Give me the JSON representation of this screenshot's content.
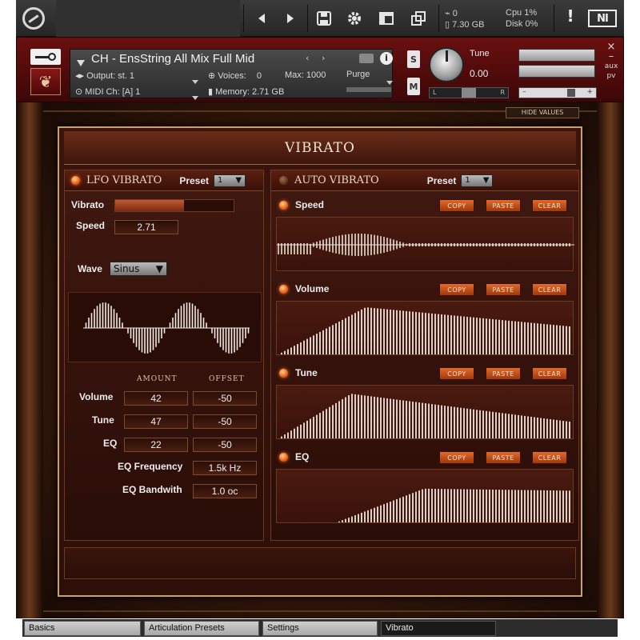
{
  "topbar": {
    "stats": {
      "voices": "0",
      "memory": "7.30 GB",
      "cpu_label": "Cpu",
      "cpu": "1%",
      "disk_label": "Disk",
      "disk": "0%"
    },
    "logo_text": "NI"
  },
  "instrument": {
    "name": "CH - EnsString All Mix Full Mid",
    "output_label": "Output:",
    "output": "st. 1",
    "voices_label": "Voices:",
    "voices": "0",
    "max_label": "Max:",
    "max": "1000",
    "purge": "Purge",
    "midi_label": "MIDI Ch:",
    "midi": "[A] 1",
    "memory_label": "Memory:",
    "memory": "2.71 GB",
    "s": "S",
    "m": "M",
    "tune_label": "Tune",
    "tune_value": "0.00",
    "pan_l": "L",
    "pan_r": "R",
    "side": {
      "close": "×",
      "minus": "–",
      "aux": "aux",
      "pv": "pv"
    }
  },
  "hide_values": "HIDE VALUES",
  "panel": {
    "title": "VIBRATO",
    "lfo": {
      "title": "LFO VIBRATO",
      "preset_label": "Preset",
      "preset": "1",
      "vibrato_label": "Vibrato",
      "vibrato_fraction": 0.58,
      "speed_label": "Speed",
      "speed": "2.71",
      "wave_label": "Wave",
      "wave": "Sinus",
      "amount_head": "AMOUNT",
      "offset_head": "OFFSET",
      "volume_label": "Volume",
      "volume_amount": "42",
      "volume_offset": "-50",
      "tune_label": "Tune",
      "tune_amount": "47",
      "tune_offset": "-50",
      "eq_label": "EQ",
      "eq_amount": "22",
      "eq_offset": "-50",
      "eq_freq_label": "EQ Frequency",
      "eq_freq": "1.5k Hz",
      "eq_bw_label": "EQ Bandwith",
      "eq_bw": "1.0 oc"
    },
    "auto": {
      "title": "AUTO VIBRATO",
      "preset_label": "Preset",
      "preset": "1",
      "copy": "COPY",
      "paste": "PASTE",
      "clear": "CLEAR",
      "envelopes": [
        {
          "title": "Speed"
        },
        {
          "title": "Volume"
        },
        {
          "title": "Tune"
        },
        {
          "title": "EQ"
        }
      ]
    }
  },
  "tabs": [
    "Basics",
    "Articulation Presets",
    "Settings",
    "Vibrato"
  ]
}
